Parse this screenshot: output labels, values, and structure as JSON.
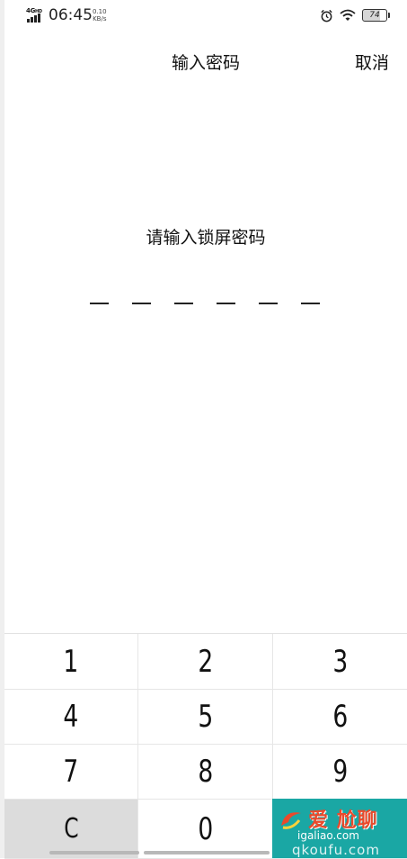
{
  "status_bar": {
    "network": "4G",
    "network_suffix": "HD",
    "time": "06:45",
    "speed_value": "0.10",
    "speed_unit": "KB/s",
    "alarm_icon": "alarm-clock-icon",
    "wifi_icon": "wifi-icon",
    "battery_level": "74"
  },
  "header": {
    "title": "输入密码",
    "cancel_label": "取消"
  },
  "prompt": "请输入锁屏密码",
  "pin": {
    "length": 6,
    "entered": 0
  },
  "keypad": {
    "keys": [
      "1",
      "2",
      "3",
      "4",
      "5",
      "6",
      "7",
      "8",
      "9",
      "C",
      "0",
      ""
    ]
  },
  "watermark": {
    "brand": "爱 尬聊",
    "domain": "igaliao.com",
    "sub": "qkoufu.com"
  },
  "colors": {
    "background": "#ffffff",
    "text": "#111111",
    "clear_key_bg": "#dcdcdc",
    "watermark_bg": "#1aa7a4"
  }
}
